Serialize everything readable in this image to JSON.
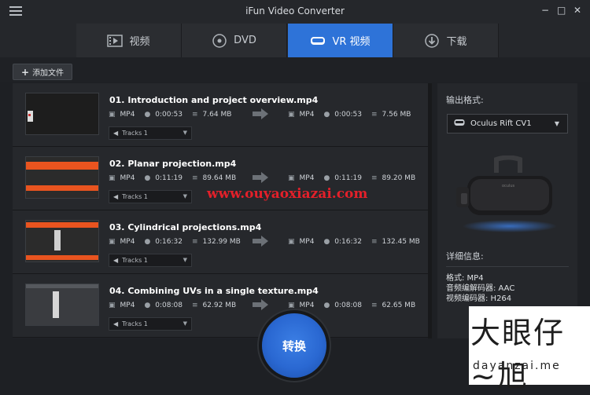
{
  "window": {
    "title": "iFun Video Converter",
    "controls": [
      "−",
      "□",
      "✕"
    ]
  },
  "tabs": [
    {
      "label": "视频",
      "icon": "film-icon",
      "active": false
    },
    {
      "label": "DVD",
      "icon": "disc-icon",
      "active": false
    },
    {
      "label": "VR 视频",
      "icon": "vr-headset-icon",
      "active": true
    },
    {
      "label": "下载",
      "icon": "download-icon",
      "active": false
    }
  ],
  "toolbar": {
    "add_file": "添加文件"
  },
  "files": [
    {
      "name": "01. Introduction and project overview.mp4",
      "src": {
        "format": "MP4",
        "duration": "0:00:53",
        "size": "7.64 MB"
      },
      "out": {
        "format": "MP4",
        "duration": "0:00:53",
        "size": "7.56 MB"
      },
      "tracks": "Tracks 1"
    },
    {
      "name": "02. Planar projection.mp4",
      "src": {
        "format": "MP4",
        "duration": "0:11:19",
        "size": "89.64 MB"
      },
      "out": {
        "format": "MP4",
        "duration": "0:11:19",
        "size": "89.20 MB"
      },
      "tracks": "Tracks 1"
    },
    {
      "name": "03. Cylindrical projections.mp4",
      "src": {
        "format": "MP4",
        "duration": "0:16:32",
        "size": "132.99 MB"
      },
      "out": {
        "format": "MP4",
        "duration": "0:16:32",
        "size": "132.45 MB"
      },
      "tracks": "Tracks 1"
    },
    {
      "name": "04. Combining UVs in a single texture.mp4",
      "src": {
        "format": "MP4",
        "duration": "0:08:08",
        "size": "62.92 MB"
      },
      "out": {
        "format": "MP4",
        "duration": "0:08:08",
        "size": "62.65 MB"
      },
      "tracks": "Tracks 1"
    }
  ],
  "right_panel": {
    "output_format_label": "输出格式:",
    "selected_device": "Oculus Rift CV1",
    "details_label": "详细信息:",
    "details": {
      "format": "格式: MP4",
      "audio": "音频编解码器: AAC",
      "video": "视频编码器: H264"
    }
  },
  "convert_button": "转换",
  "watermarks": {
    "site": "www.ouyaoxiazai.com",
    "logo_text": "大眼仔~旭",
    "logo_url": "dayanzai.me"
  },
  "colors": {
    "accent": "#2e73d8",
    "watermark_red": "#e3202a"
  }
}
